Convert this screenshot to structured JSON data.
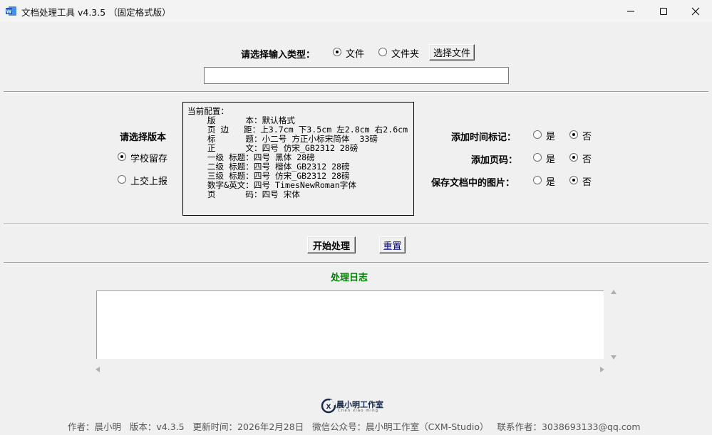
{
  "window": {
    "title": "文档处理工具 v4.3.5  （固定格式版）"
  },
  "input_type": {
    "label": "请选择输入类型：",
    "option_file": "文件",
    "option_folder": "文件夹",
    "selected": "文件",
    "choose_button": "选择文件",
    "path_value": ""
  },
  "version_select": {
    "label": "请选择版本",
    "option_school": "学校留存",
    "option_submit": "上交上报",
    "selected": "学校留存"
  },
  "config": {
    "header": "当前配置：",
    "lines": [
      "    版      本：默认格式",
      "    页 边   距：上3.7cm 下3.5cm 左2.8cm 右2.6cm",
      "    标      题：小二号 方正小标宋简体  33磅",
      "    正      文：四号 仿宋_GB2312 28磅",
      "    一级 标题：四号 黑体 28磅",
      "    二级 标题：四号 楷体_GB2312 28磅",
      "    三级 标题：四号 仿宋_GB2312 28磅",
      "    数字&英文：四号 TimesNewRoman字体",
      "    页      码：四号 宋体"
    ]
  },
  "options": {
    "timestamp": {
      "label": "添加时间标记：",
      "yes": "是",
      "no": "否",
      "selected": "否"
    },
    "page_number": {
      "label": "添加页码：",
      "yes": "是",
      "no": "否",
      "selected": "否"
    },
    "keep_images": {
      "label": "保存文档中的图片：",
      "yes": "是",
      "no": "否",
      "selected": "否"
    }
  },
  "actions": {
    "start_button": "开始处理",
    "reset_button": "重置"
  },
  "log": {
    "title": "处理日志",
    "content": ""
  },
  "branding": {
    "logo_text": "晨小明工作室",
    "logo_subtext": "Chen xiao ming"
  },
  "footer": {
    "text": "作者：晨小明   版本：v4.3.5   更新时间：2026年2月28日   微信公众号：晨小明工作室（CXM-Studio）   联系作者：3038693133@qq.com"
  },
  "colors": {
    "log_title": "#008000",
    "reset_text": "#000080",
    "footer_text": "#555555"
  }
}
